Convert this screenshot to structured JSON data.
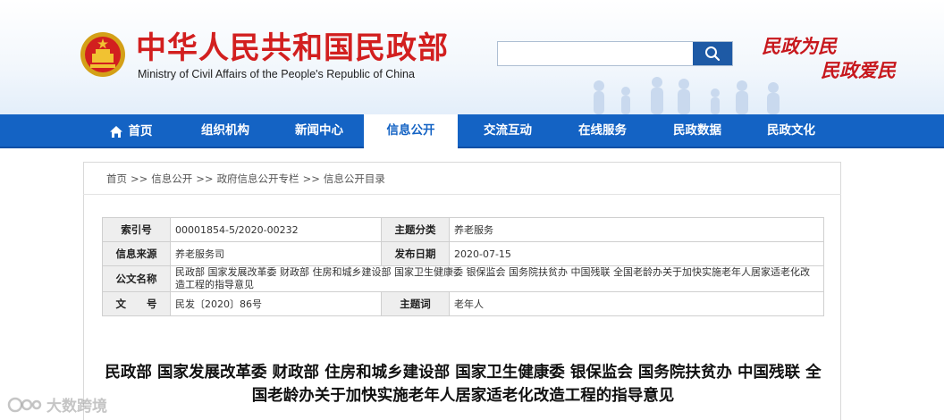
{
  "header": {
    "title": "中华人民共和国民政部",
    "subtitle": "Ministry of Civil Affairs of the People's Republic of China",
    "slogan_line1": "民政为民",
    "slogan_line2": "民政爱民",
    "search_placeholder": "",
    "emblem_icon": "national-emblem-icon",
    "search_icon": "magnifier-icon"
  },
  "nav": {
    "items": [
      {
        "label": "首页",
        "icon": "home-icon"
      },
      {
        "label": "组织机构"
      },
      {
        "label": "新闻中心"
      },
      {
        "label": "信息公开",
        "active": true
      },
      {
        "label": "交流互动"
      },
      {
        "label": "在线服务"
      },
      {
        "label": "民政数据"
      },
      {
        "label": "民政文化"
      }
    ]
  },
  "breadcrumb": {
    "items": [
      "首页",
      "信息公开",
      "政府信息公开专栏",
      "信息公开目录"
    ],
    "separator": ">>"
  },
  "info_table": {
    "index_label": "索引号",
    "index_value": "00001854-5/2020-00232",
    "category_label": "主题分类",
    "category_value": "养老服务",
    "source_label": "信息来源",
    "source_value": "养老服务司",
    "date_label": "发布日期",
    "date_value": "2020-07-15",
    "issuer_label": "公文名称",
    "issuer_value": "民政部 国家发展改革委 财政部 住房和城乡建设部 国家卫生健康委 银保监会 国务院扶贫办 中国残联 全国老龄办关于加快实施老年人居家适老化改造工程的指导意见",
    "docno_label": "文　　号",
    "docno_value": "民发〔2020〕86号",
    "keyword_label": "主题词",
    "keyword_value": "老年人"
  },
  "document": {
    "title": "民政部 国家发展改革委 财政部 住房和城乡建设部 国家卫生健康委 银保监会 国务院扶贫办 中国残联 全国老龄办关于加快实施老年人居家适老化改造工程的指导意见"
  },
  "watermark": {
    "text": "大数跨境",
    "icon": "brand-logo-icon"
  },
  "colors": {
    "nav_blue": "#1463c4",
    "title_red": "#d21f1f",
    "search_button": "#1e5aa5",
    "label_bg": "#eeeeee"
  }
}
